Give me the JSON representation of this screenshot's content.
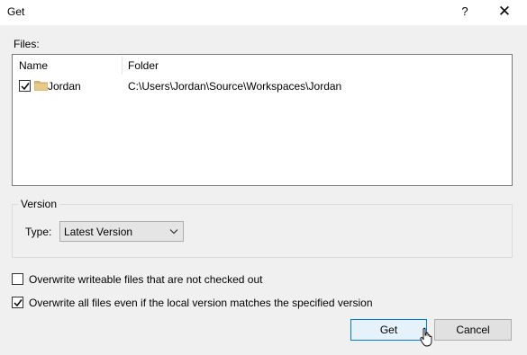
{
  "window": {
    "title": "Get",
    "help_label": "?",
    "close_label": "✕"
  },
  "files": {
    "label": "Files:",
    "columns": {
      "name": "Name",
      "folder": "Folder"
    },
    "rows": [
      {
        "checked": true,
        "name": "Jordan",
        "folder": "C:\\Users\\Jordan\\Source\\Workspaces\\Jordan"
      }
    ]
  },
  "version": {
    "group_label": "Version",
    "type_label": "Type:",
    "type_value": "Latest Version"
  },
  "options": [
    {
      "label": "Overwrite writeable files that are not checked out",
      "checked": false
    },
    {
      "label": "Overwrite all files even if the local version matches the specified version",
      "checked": true
    }
  ],
  "buttons": {
    "get": "Get",
    "cancel": "Cancel"
  },
  "colors": {
    "accent": "#0078d7",
    "folder": "#dcb67a"
  },
  "icons": {
    "close": "close-icon",
    "help": "help-icon",
    "folder": "folder-icon",
    "dropdown": "chevron-down-icon",
    "cursor": "mouse-pointer-icon",
    "check": "checkmark-icon"
  }
}
